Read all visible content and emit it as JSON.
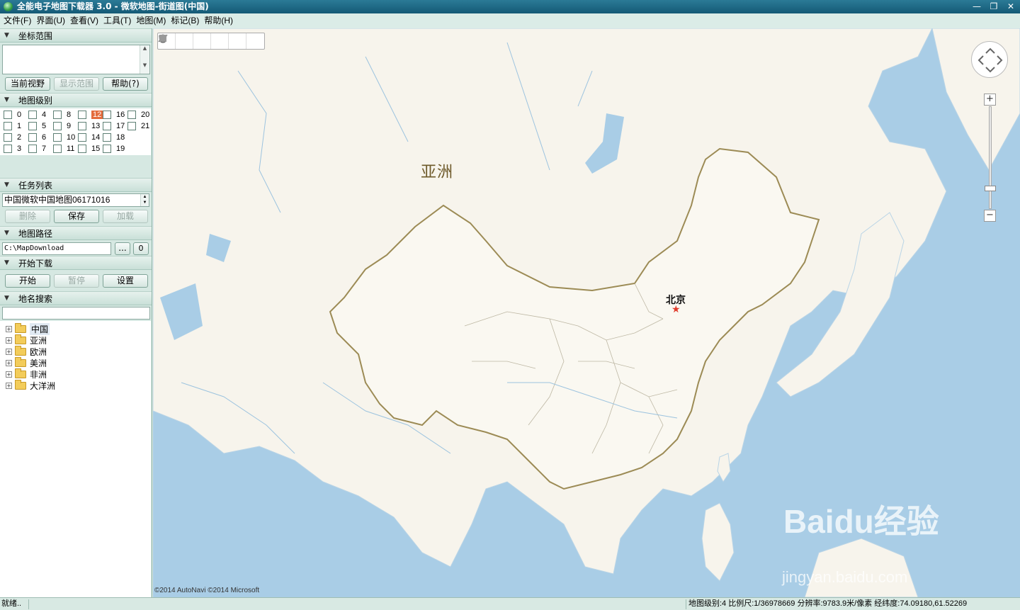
{
  "window": {
    "title": "全能电子地图下载器 3.0 - 微软地图-街道图(中国)",
    "minimize": "—",
    "maximize": "❐",
    "close": "✕"
  },
  "menu": [
    {
      "label": "文件(F)"
    },
    {
      "label": "界面(U)"
    },
    {
      "label": "查看(V)"
    },
    {
      "label": "工具(T)"
    },
    {
      "label": "地图(M)"
    },
    {
      "label": "标记(B)"
    },
    {
      "label": "帮助(H)"
    }
  ],
  "sidebar": {
    "coord_section": {
      "title": "坐标范围",
      "btn_current_view": "当前视野",
      "btn_show_range": "显示范围",
      "btn_help": "帮助(?)"
    },
    "level_section": {
      "title": "地图级别",
      "levels": [
        "0",
        "1",
        "2",
        "3",
        "4",
        "5",
        "6",
        "7",
        "8",
        "9",
        "10",
        "11",
        "12",
        "13",
        "14",
        "15",
        "16",
        "17",
        "18",
        "19",
        "20",
        "21"
      ],
      "highlighted": "12"
    },
    "task_section": {
      "title": "任务列表",
      "selected_task": "中国微软中国地图06171016",
      "btn_delete": "删除",
      "btn_save": "保存",
      "btn_load": "加载"
    },
    "path_section": {
      "title": "地图路径",
      "path_value": "C:\\MapDownload",
      "btn_browse": "...",
      "btn_open": "0"
    },
    "download_section": {
      "title": "开始下载",
      "btn_start": "开始",
      "btn_pause": "暂停",
      "btn_settings": "设置"
    },
    "search_section": {
      "title": "地名搜索",
      "search_value": "",
      "tree": [
        {
          "label": "中国"
        },
        {
          "label": "亚洲"
        },
        {
          "label": "欧洲"
        },
        {
          "label": "美洲"
        },
        {
          "label": "非洲"
        },
        {
          "label": "大洋洲"
        }
      ]
    }
  },
  "map": {
    "label_continent": "亚洲",
    "label_capital": "北京",
    "copyright": "©2014 AutoNavi ©2014 Microsoft",
    "zoom_in": "+",
    "zoom_out": "−",
    "watermark": "Baidu经验",
    "watermark_url": "jingyan.baidu.com"
  },
  "status": {
    "left": "就绪..",
    "right": "地图级别:4 比例尺:1/36978669 分辨率:9783.9米/像素  经纬度:74.09180,61.52269"
  },
  "colors": {
    "sea": "#a9cde6",
    "land": "#f7f4ec",
    "border": "#9c8b55",
    "highlight_level": "#e46b3c"
  }
}
